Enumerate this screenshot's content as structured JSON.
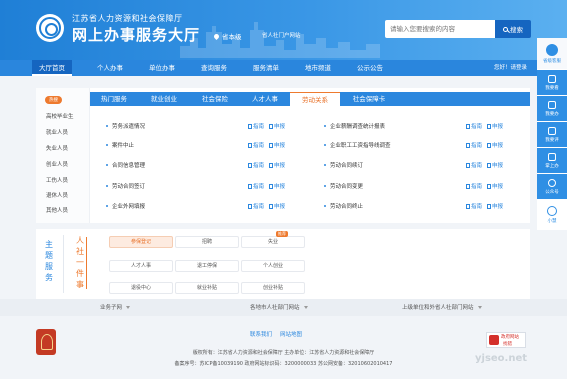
{
  "header": {
    "org": "江苏省人力资源和社会保障厅",
    "site": "网上办事服务大厅",
    "location": "省本级",
    "entry_link": "省人社门户网站",
    "search_placeholder": "请输入您要搜索的内容",
    "search_button": "搜索"
  },
  "nav": {
    "items": [
      "大厅首页",
      "个人办事",
      "单位办事",
      "查询服务",
      "服务清单",
      "地市频道",
      "公示公告"
    ],
    "right": "您好！请登录"
  },
  "sidebar": {
    "items": [
      "省级客服",
      "我要看",
      "我要办",
      "我要评",
      "掌上办",
      "公众号",
      "小慧"
    ]
  },
  "categories": {
    "badge": "热搜",
    "items": [
      "高校毕业生",
      "就业人员",
      "失业人员",
      "创业人员",
      "工伤人员",
      "退休人员",
      "其他人员"
    ]
  },
  "tabs": {
    "items": [
      "热门服务",
      "就业创业",
      "社会保险",
      "人才人事",
      "劳动关系",
      "社会保障卡"
    ],
    "active": "劳动关系"
  },
  "services": [
    {
      "name": "劳务派遣情况"
    },
    {
      "name": "企业薪酬调查统计报表"
    },
    {
      "name": "案件中止"
    },
    {
      "name": "企业职工工资指导线调查"
    },
    {
      "name": "合同信息管理"
    },
    {
      "name": "劳动合同续订"
    },
    {
      "name": "劳动合同签订"
    },
    {
      "name": "劳动合同变更"
    },
    {
      "name": "企业外网填报"
    },
    {
      "name": "劳动合同终止"
    }
  ],
  "links": {
    "guide": "指南",
    "apply": "申报"
  },
  "theme": {
    "title": "主题服务",
    "subtitle": "人社一件事",
    "hot_badge": "推荐",
    "chips": [
      "参保登记",
      "招聘",
      "失业",
      "人才人事",
      "退工停保",
      "个人创业",
      "退役中心",
      "就业补贴",
      "创业补贴"
    ]
  },
  "linkbar": {
    "items": [
      "业务子网",
      "各地市人社部门网站",
      "上级单位和外省人社部门网站"
    ]
  },
  "footer": {
    "links": [
      "联系我们",
      "网站地图"
    ],
    "line1": "版权所有：江苏省人力资源和社会保障厅    主办单位：江苏省人力资源和社会保障厅",
    "line2": "备案序号：苏ICP备10039190    政府网站标识码：3200000033    苏公网安备：32010602010417",
    "gov_badge_1": "政府网站",
    "gov_badge_2": "找错",
    "watermark": "yjseo.net"
  }
}
